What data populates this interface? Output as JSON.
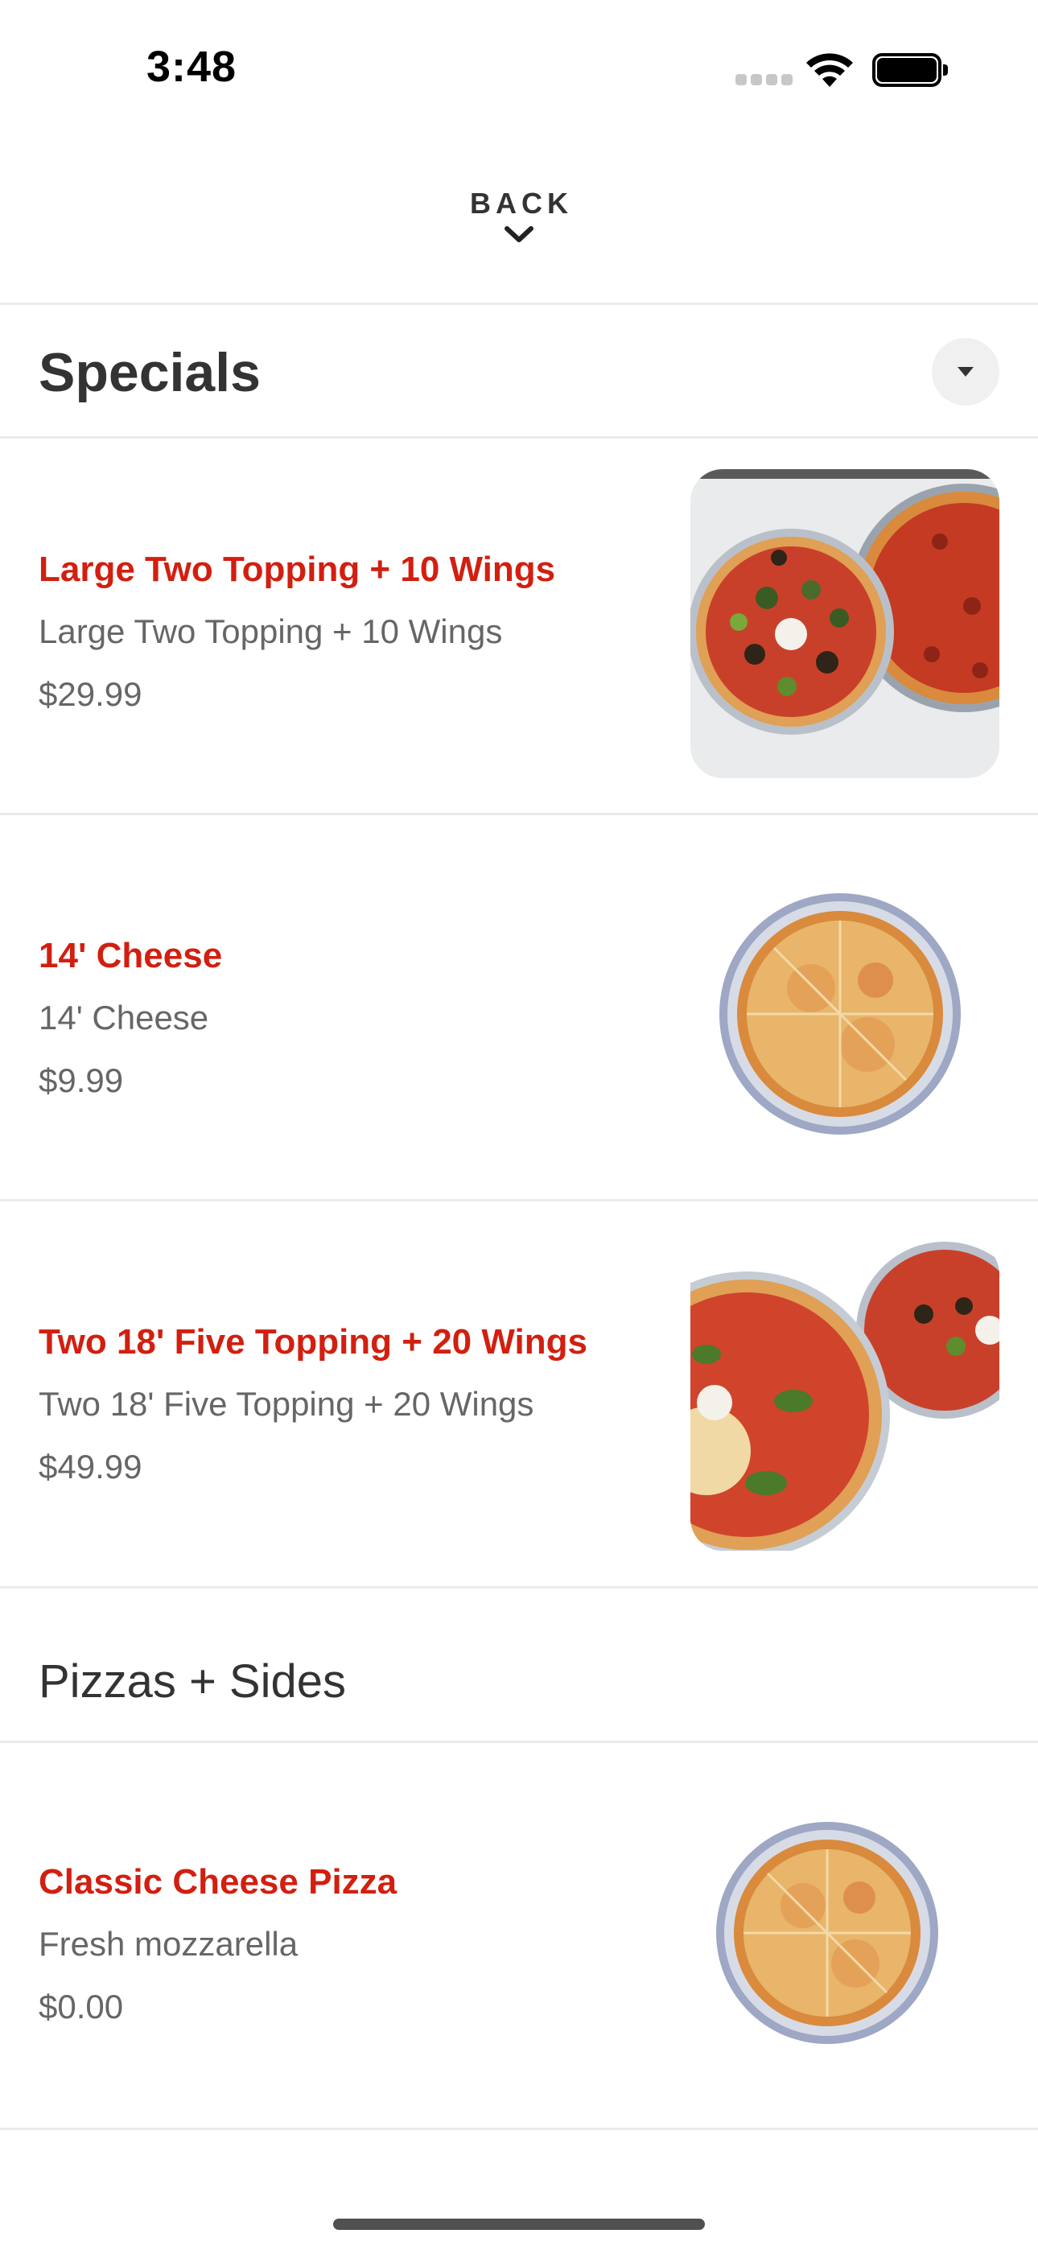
{
  "status_bar": {
    "time": "3:48",
    "icons": [
      "cellular-signal-icon",
      "wifi-icon",
      "battery-icon"
    ]
  },
  "nav": {
    "back_label": "BACK",
    "back_icon": "chevron-down-icon"
  },
  "sections": [
    {
      "title": "Specials",
      "toggle_icon": "caret-down-icon",
      "items": [
        {
          "name": "Large Two Topping + 10 Wings",
          "description": "Large Two Topping + 10 Wings",
          "price": "$29.99"
        },
        {
          "name": "14' Cheese",
          "description": "14' Cheese",
          "price": "$9.99"
        },
        {
          "name": "Two 18' Five Topping + 20 Wings",
          "description": "Two 18' Five Topping + 20 Wings",
          "price": "$49.99"
        }
      ]
    },
    {
      "title": "Pizzas + Sides",
      "items": [
        {
          "name": "Classic Cheese Pizza",
          "description": "Fresh mozzarella",
          "price": "$0.00"
        }
      ]
    }
  ],
  "colors": {
    "accent": "#d21f10",
    "text_primary": "#333333",
    "text_secondary": "#666666",
    "divider": "#ebebeb"
  }
}
